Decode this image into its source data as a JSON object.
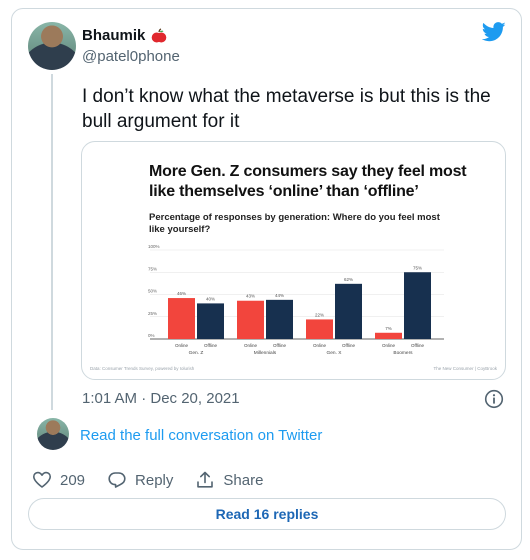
{
  "tweet": {
    "display_name": "Bhaumik",
    "name_emoji": "apple-emoji",
    "handle": "@patel0phone",
    "text": "I don’t know what the metaverse is but this is the bull argument for it",
    "timestamp": "1:01 AM · Dec 20, 2021"
  },
  "links": {
    "read_full": "Read the full conversation on Twitter"
  },
  "actions": {
    "likes": "209",
    "reply_label": "Reply",
    "share_label": "Share"
  },
  "read_replies_button": "Read 16 replies",
  "colors": {
    "accent": "#1d9bf0",
    "online": "#f2453d",
    "offline": "#17304f"
  },
  "chart_data": {
    "type": "bar",
    "title": "More Gen. Z consumers say they feel most like themselves ‘online’ than ‘offline’",
    "subtitle": "Percentage of responses by generation: Where do you feel most like yourself?",
    "ylim": [
      0,
      100
    ],
    "yticks": [
      "100%",
      "75%",
      "50%",
      "25%",
      "0%"
    ],
    "groups": [
      "Gen. Z",
      "Millennials",
      "Gen. X",
      "Boomers"
    ],
    "bar_labels": [
      "Online",
      "Offline"
    ],
    "series": [
      {
        "name": "Online",
        "values": [
          46,
          43,
          22,
          7
        ],
        "labels": [
          "46%",
          "43%",
          "22%",
          "7%"
        ]
      },
      {
        "name": "Offline",
        "values": [
          40,
          44,
          62,
          75
        ],
        "labels": [
          "40%",
          "44%",
          "62%",
          "75%"
        ]
      }
    ],
    "source_left": "Data: Consumer Trends Survey, powered by Iolurish",
    "source_right": "The New Consumer | CoyBrook"
  }
}
